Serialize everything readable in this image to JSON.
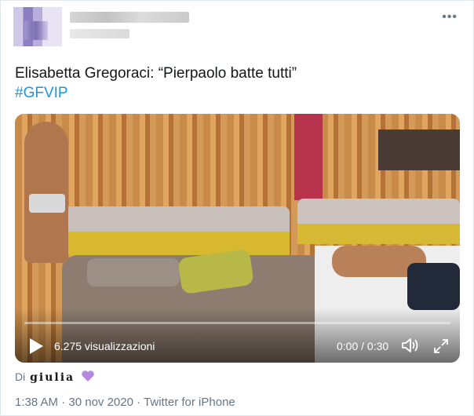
{
  "header": {
    "more_label": "•••"
  },
  "tweet": {
    "text": "Elisabetta Gregoraci: “Pierpaolo batte tutti”",
    "hashtag": "#GFVIP"
  },
  "video": {
    "views": "6.275 visualizzazioni",
    "time": "0:00 / 0:30",
    "progress": 0,
    "play_icon": "play-icon",
    "volume_icon": "volume-icon",
    "fullscreen_icon": "fullscreen-icon"
  },
  "attribution": {
    "prefix": "Di",
    "user": "giulia",
    "heart_icon": "purple-heart-icon",
    "heart_color": "#b389e0"
  },
  "meta": {
    "time": "1:38 AM",
    "separator1": " · ",
    "date": "30 nov 2020",
    "separator2": " · ",
    "source": "Twitter for iPhone"
  },
  "colors": {
    "link": "#1b95e0",
    "muted": "#657786",
    "progress": "#1da1f2"
  }
}
